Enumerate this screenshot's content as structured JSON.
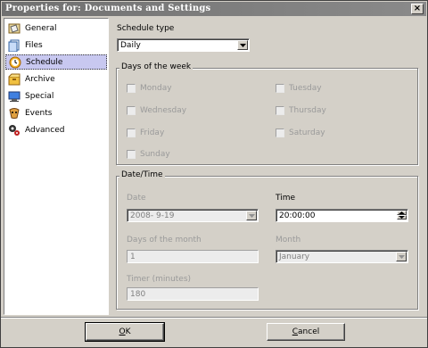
{
  "window": {
    "title": "Properties for: Documents and Settings"
  },
  "sidebar": {
    "items": [
      {
        "label": "General",
        "icon": "general-icon"
      },
      {
        "label": "Files",
        "icon": "files-icon"
      },
      {
        "label": "Schedule",
        "icon": "schedule-icon",
        "selected": true
      },
      {
        "label": "Archive",
        "icon": "archive-icon"
      },
      {
        "label": "Special",
        "icon": "special-icon"
      },
      {
        "label": "Events",
        "icon": "events-icon"
      },
      {
        "label": "Advanced",
        "icon": "advanced-icon"
      }
    ]
  },
  "schedule": {
    "type_label": "Schedule type",
    "type_value": "Daily",
    "days_group_title": "Days of the week",
    "days": {
      "monday": "Monday",
      "tuesday": "Tuesday",
      "wednesday": "Wednesday",
      "thursday": "Thursday",
      "friday": "Friday",
      "saturday": "Saturday",
      "sunday": "Sunday"
    },
    "datetime_group_title": "Date/Time",
    "date_label": "Date",
    "date_value": "2008-  9-19",
    "time_label": "Time",
    "time_value": "20:00:00",
    "days_of_month_label": "Days of the month",
    "days_of_month_value": "1",
    "month_label": "Month",
    "month_value": "January",
    "timer_label": "Timer (minutes)",
    "timer_value": "180"
  },
  "buttons": {
    "ok_accel": "O",
    "ok_rest": "K",
    "cancel_accel": "C",
    "cancel_rest": "ancel"
  },
  "colors": {
    "selection": "#c8c8f0",
    "face": "#d4d0c8"
  }
}
